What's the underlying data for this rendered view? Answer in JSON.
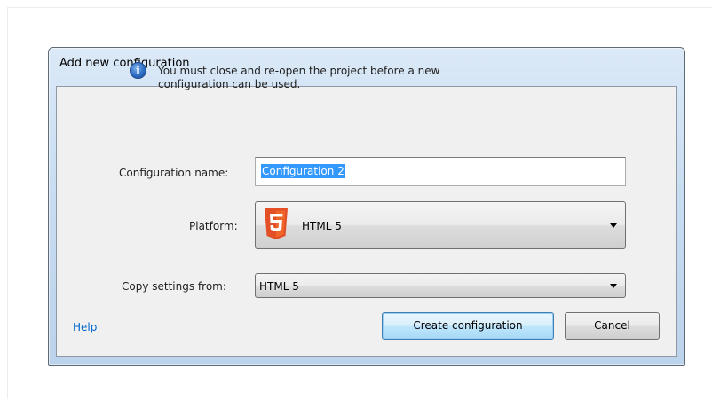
{
  "dialog": {
    "title": "Add new configuration",
    "info_line_1": "You must close and re-open the project before a new",
    "info_line_2": "configuration can be used.",
    "info_icon": "info-icon"
  },
  "form": {
    "name_label": "Configuration name:",
    "name_value": "Configuration 2",
    "platform_label": "Platform:",
    "platform_value": "HTML 5",
    "platform_icon": "html5-logo",
    "copy_label": "Copy settings from:",
    "copy_value": "HTML 5"
  },
  "footer": {
    "help_label": "Help",
    "create_label": "Create configuration",
    "cancel_label": "Cancel"
  },
  "colors": {
    "accent": "#3399ff",
    "link": "#0066cc",
    "html5_orange": "#e34f26"
  }
}
